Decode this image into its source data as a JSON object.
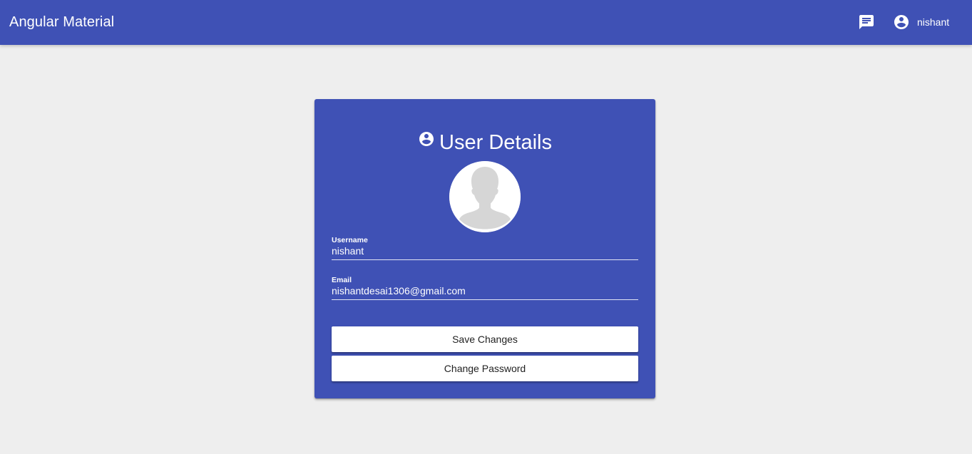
{
  "toolbar": {
    "title": "Angular Material",
    "messages_icon": "chat-message-icon",
    "account_icon": "account-circle-icon",
    "username": "nishant"
  },
  "card": {
    "heading_icon": "account-circle-icon",
    "heading": "User Details",
    "avatar": "default-user-avatar",
    "username": {
      "label": "Username",
      "value": "nishant"
    },
    "email": {
      "label": "Email",
      "value": "nishantdesai1306@gmail.com"
    },
    "save_label": "Save Changes",
    "change_password_label": "Change Password"
  },
  "colors": {
    "primary": "#3f51b5",
    "background": "#eeeeee",
    "button": "#ffffff"
  }
}
